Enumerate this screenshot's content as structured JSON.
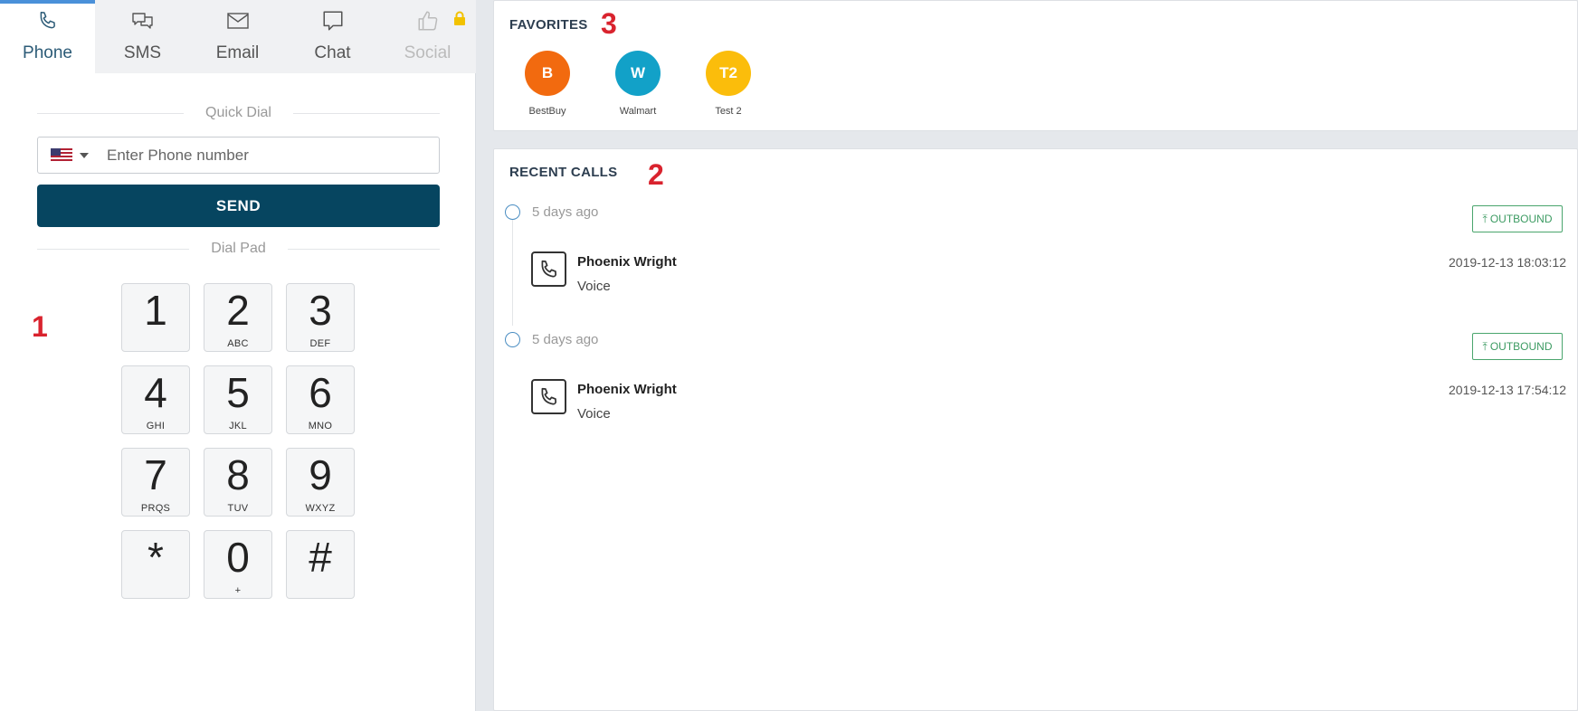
{
  "tabs": [
    {
      "label": "Phone",
      "icon": "phone-icon",
      "active": true
    },
    {
      "label": "SMS",
      "icon": "chat-bubbles-icon"
    },
    {
      "label": "Email",
      "icon": "envelope-icon"
    },
    {
      "label": "Chat",
      "icon": "chat-bubble-icon"
    },
    {
      "label": "Social",
      "icon": "thumbs-up-icon",
      "disabled": true,
      "locked": true
    }
  ],
  "quick_dial": {
    "label": "Quick Dial",
    "country": "US",
    "placeholder": "Enter Phone number",
    "send_label": "SEND"
  },
  "dial_pad": {
    "label": "Dial Pad",
    "keys": [
      {
        "digit": "1",
        "letters": ""
      },
      {
        "digit": "2",
        "letters": "ABC"
      },
      {
        "digit": "3",
        "letters": "DEF"
      },
      {
        "digit": "4",
        "letters": "GHI"
      },
      {
        "digit": "5",
        "letters": "JKL"
      },
      {
        "digit": "6",
        "letters": "MNO"
      },
      {
        "digit": "7",
        "letters": "PRQS"
      },
      {
        "digit": "8",
        "letters": "TUV"
      },
      {
        "digit": "9",
        "letters": "WXYZ"
      },
      {
        "digit": "*",
        "letters": ""
      },
      {
        "digit": "0",
        "letters": "+"
      },
      {
        "digit": "#",
        "letters": ""
      }
    ]
  },
  "annotations": {
    "dialpad": "1",
    "recent": "2",
    "favorites": "3"
  },
  "favorites": {
    "title": "FAVORITES",
    "items": [
      {
        "initials": "B",
        "name": "BestBuy",
        "color": "#f26a0f"
      },
      {
        "initials": "W",
        "name": "Walmart",
        "color": "#12a1c8"
      },
      {
        "initials": "T2",
        "name": "Test 2",
        "color": "#fbbd0b"
      }
    ]
  },
  "recent_calls": {
    "title": "RECENT CALLS",
    "items": [
      {
        "when": "5 days ago",
        "direction": "OUTBOUND",
        "caller": "Phoenix Wright",
        "type": "Voice",
        "datetime": "2019-12-13 18:03:12"
      },
      {
        "when": "5 days ago",
        "direction": "OUTBOUND",
        "caller": "Phoenix Wright",
        "type": "Voice",
        "datetime": "2019-12-13 17:54:12"
      }
    ]
  },
  "colors": {
    "accent": "#064560",
    "outbound": "#3c9b62",
    "annotation": "#d9232e"
  }
}
